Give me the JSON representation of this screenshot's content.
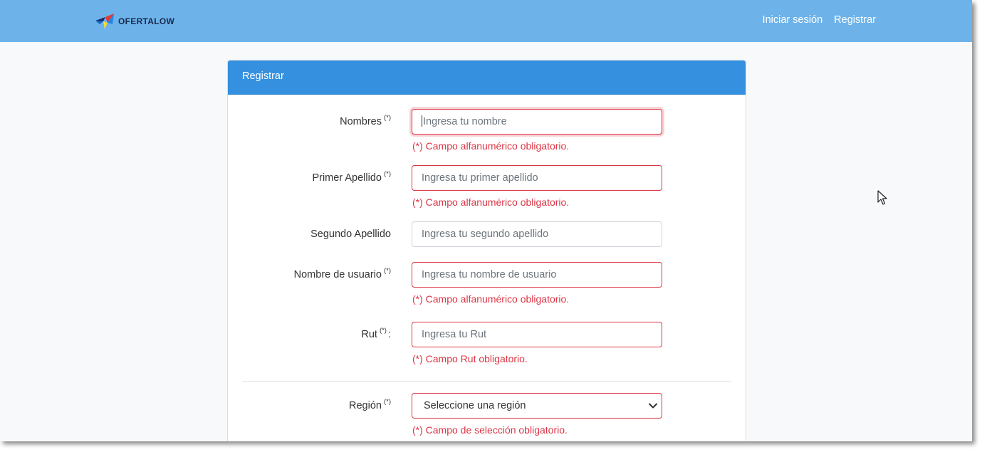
{
  "navbar": {
    "brand": "OFERTALOW",
    "links": [
      "Iniciar sesión",
      "Registrar"
    ]
  },
  "card": {
    "title": "Registrar"
  },
  "form": {
    "required_mark": "(*)",
    "fields": [
      {
        "label": "Nombres",
        "required": true,
        "placeholder": "Ingresa tu nombre",
        "error": "(*) Campo alfanumérico obligatorio."
      },
      {
        "label": "Primer Apellido",
        "required": true,
        "placeholder": "Ingresa tu primer apellido",
        "error": "(*) Campo alfanumérico obligatorio."
      },
      {
        "label": "Segundo Apellido",
        "required": false,
        "placeholder": "Ingresa tu segundo apellido"
      },
      {
        "label": "Nombre de usuario",
        "required": true,
        "placeholder": "Ingresa tu nombre de usuario",
        "error": "(*) Campo alfanumérico obligatorio."
      },
      {
        "label": "Rut",
        "required": true,
        "suffix": ":",
        "placeholder": "Ingresa tu Rut",
        "error": "(*) Campo Rut obligatorio."
      },
      {
        "label": "Región",
        "required": true,
        "selected": "Seleccione una región",
        "error": "(*) Campo de selección obligatorio."
      }
    ]
  },
  "colors": {
    "navbar": "#6db3ea",
    "card_header": "#3591e0",
    "error": "#dc3545"
  },
  "icons": [
    "ofertalow-logo-icon",
    "chevron-down-icon",
    "mouse-pointer-icon"
  ]
}
